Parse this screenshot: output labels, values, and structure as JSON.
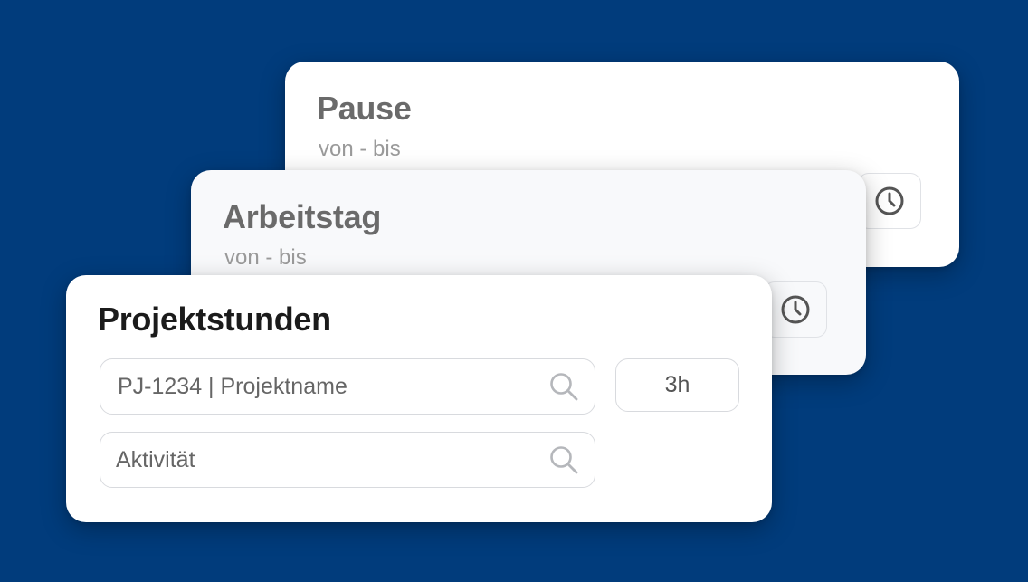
{
  "colors": {
    "background": "#013C7C",
    "card": "#FFFFFF",
    "title_active": "#1B1B1B",
    "title_inactive": "#6A6A6A",
    "subtitle": "#9A9A9A",
    "border": "#D8DADE"
  },
  "cards": {
    "pause": {
      "title": "Pause",
      "subtitle": "von - bis",
      "time_icon": "clock-icon"
    },
    "arbeitstag": {
      "title": "Arbeitstag",
      "subtitle": "von - bis",
      "time_icon": "clock-icon"
    },
    "projektstunden": {
      "title": "Projektstunden",
      "project_field": {
        "placeholder": "PJ-1234 | Projektname",
        "icon": "search-icon"
      },
      "activity_field": {
        "placeholder": "Aktivität",
        "icon": "search-icon"
      },
      "hours_value": "3h"
    }
  }
}
